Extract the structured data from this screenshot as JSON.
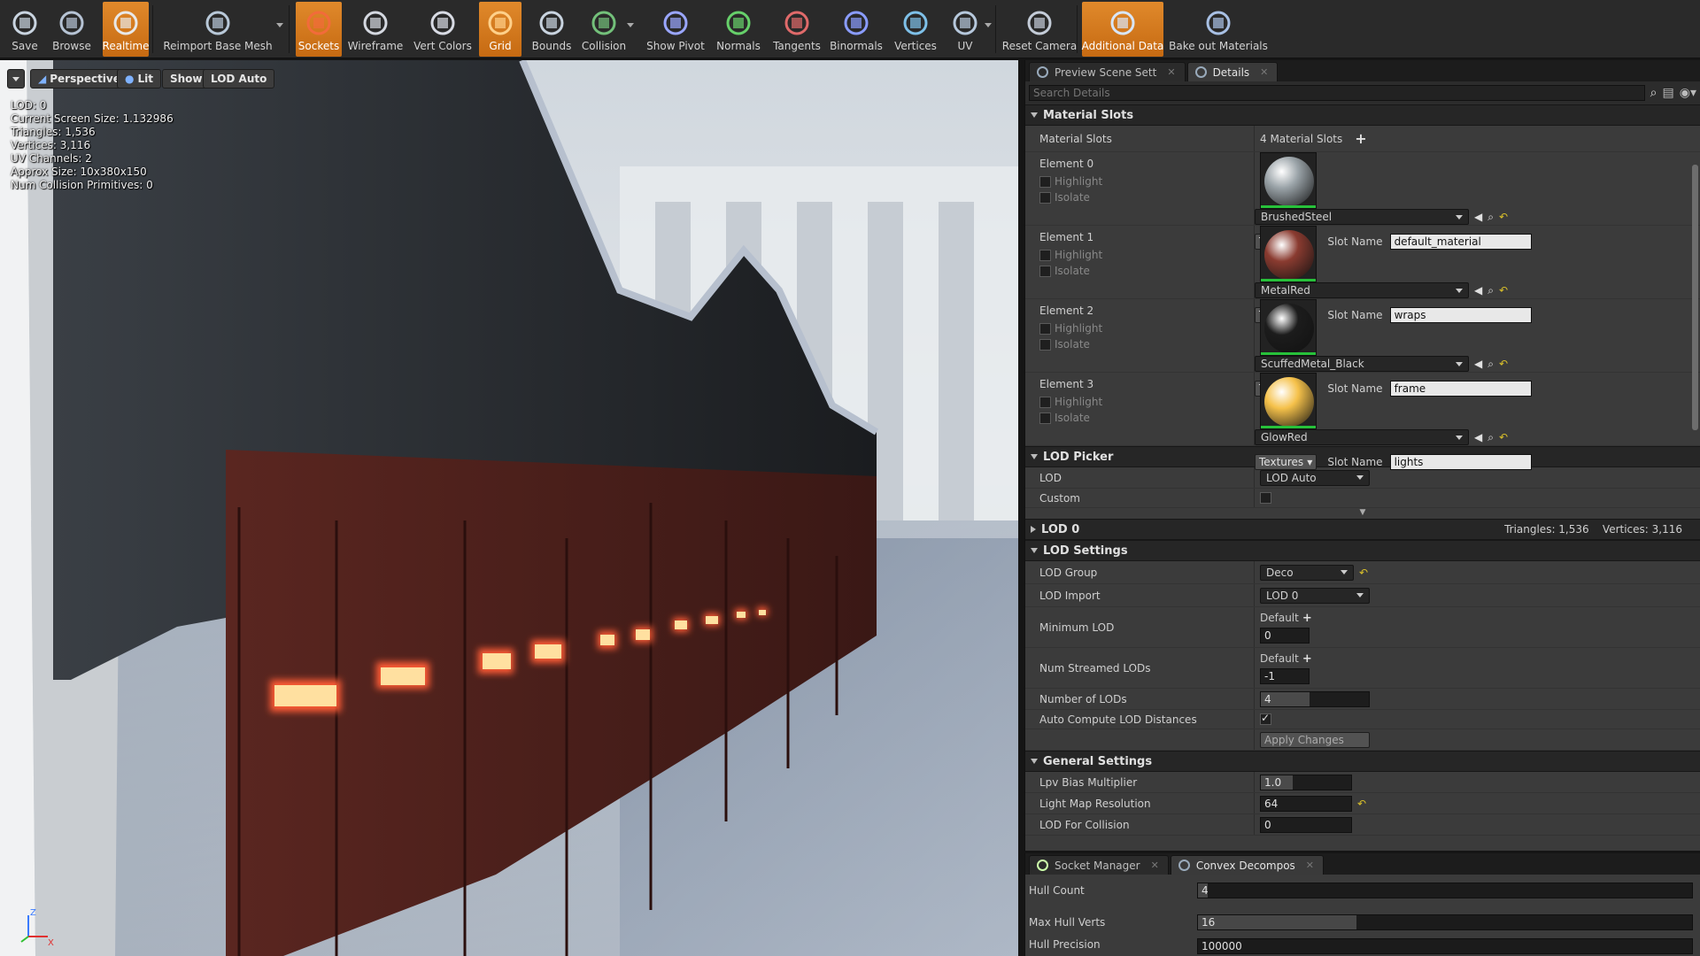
{
  "toolbar": {
    "buttons": [
      {
        "label": "Save",
        "icon": "save-icon",
        "active": false
      },
      {
        "label": "Browse",
        "icon": "browse-icon",
        "active": false
      },
      {
        "label": "Realtime",
        "icon": "realtime-icon",
        "active": true
      },
      {
        "label": "Reimport Base Mesh",
        "icon": "reimport-icon",
        "active": false
      },
      {
        "label": "Sockets",
        "icon": "sockets-icon",
        "active": true
      },
      {
        "label": "Wireframe",
        "icon": "wireframe-icon",
        "active": false
      },
      {
        "label": "Vert Colors",
        "icon": "vert-colors-icon",
        "active": false
      },
      {
        "label": "Grid",
        "icon": "grid-icon",
        "active": true
      },
      {
        "label": "Bounds",
        "icon": "bounds-icon",
        "active": false
      },
      {
        "label": "Collision",
        "icon": "collision-icon",
        "active": false
      },
      {
        "label": "Show Pivot",
        "icon": "pivot-icon",
        "active": false
      },
      {
        "label": "Normals",
        "icon": "normals-icon",
        "active": false
      },
      {
        "label": "Tangents",
        "icon": "tangents-icon",
        "active": false
      },
      {
        "label": "Binormals",
        "icon": "binormals-icon",
        "active": false
      },
      {
        "label": "Vertices",
        "icon": "vertices-icon",
        "active": false
      },
      {
        "label": "UV",
        "icon": "uv-icon",
        "active": false
      },
      {
        "label": "Reset Camera",
        "icon": "reset-camera-icon",
        "active": false
      },
      {
        "label": "Additional Data",
        "icon": "additional-data-icon",
        "active": true
      },
      {
        "label": "Bake out Materials",
        "icon": "bake-icon",
        "active": false
      }
    ]
  },
  "viewport": {
    "perspective": "Perspective",
    "lit": "Lit",
    "show": "Show",
    "lod": "LOD Auto",
    "stats": [
      "LOD:  0",
      "Current Screen Size:  1.132986",
      "Triangles:  1,536",
      "Vertices:  3,116",
      "UV Channels:  2",
      "Approx Size: 10x380x150",
      "Num Collision Primitives:  0"
    ],
    "axis_z": "Z",
    "axis_x": "X"
  },
  "details": {
    "tabs": [
      {
        "label": "Preview Scene Sett",
        "selected": false
      },
      {
        "label": "Details",
        "selected": true
      }
    ],
    "search_placeholder": "Search Details",
    "material_slots": {
      "header": "Material Slots",
      "label": "Material Slots",
      "count": "4 Material Slots",
      "elements": [
        {
          "name": "Element 0",
          "material": "BrushedSteel",
          "slot": "default_material",
          "color": "#9aa3a8"
        },
        {
          "name": "Element 1",
          "material": "MetalRed",
          "slot": "wraps",
          "color": "#8a3b30"
        },
        {
          "name": "Element 2",
          "material": "ScuffedMetal_Black",
          "slot": "frame",
          "color": "#1c1c1c"
        },
        {
          "name": "Element 3",
          "material": "GlowRed",
          "slot": "lights",
          "color": "#f5c14a"
        }
      ],
      "highlight": "Highlight",
      "isolate": "Isolate",
      "textures": "Textures",
      "slot_name": "Slot Name"
    },
    "lod_picker": {
      "header": "LOD Picker",
      "lod_label": "LOD",
      "lod_value": "LOD Auto",
      "custom_label": "Custom"
    },
    "lod0": {
      "header": "LOD 0",
      "summary": "Triangles: 1,536    Vertices: 3,116"
    },
    "lod_settings": {
      "header": "LOD Settings",
      "lod_group_label": "LOD Group",
      "lod_group_value": "Deco",
      "lod_import_label": "LOD Import",
      "lod_import_value": "LOD 0",
      "min_lod_label": "Minimum LOD",
      "min_lod_default": "Default",
      "min_lod_value": "0",
      "num_streamed_label": "Num Streamed LODs",
      "num_streamed_default": "Default",
      "num_streamed_value": "-1",
      "num_lods_label": "Number of LODs",
      "num_lods_value": "4",
      "auto_compute_label": "Auto Compute LOD Distances",
      "apply_changes": "Apply Changes"
    },
    "general": {
      "header": "General Settings",
      "lpv_label": "Lpv Bias Multiplier",
      "lpv_value": "1.0",
      "lightmap_label": "Light Map Resolution",
      "lightmap_value": "64",
      "lod_collision_label": "LOD For Collision",
      "lod_collision_value": "0"
    }
  },
  "bottom": {
    "tabs": [
      {
        "label": "Socket Manager",
        "selected": false
      },
      {
        "label": "Convex Decompos",
        "selected": true
      }
    ],
    "hull_count_label": "Hull Count",
    "hull_count_value": "4",
    "max_hull_verts_label": "Max Hull Verts",
    "max_hull_verts_value": "16",
    "hull_precision_label": "Hull Precision",
    "hull_precision_value": "100000"
  }
}
